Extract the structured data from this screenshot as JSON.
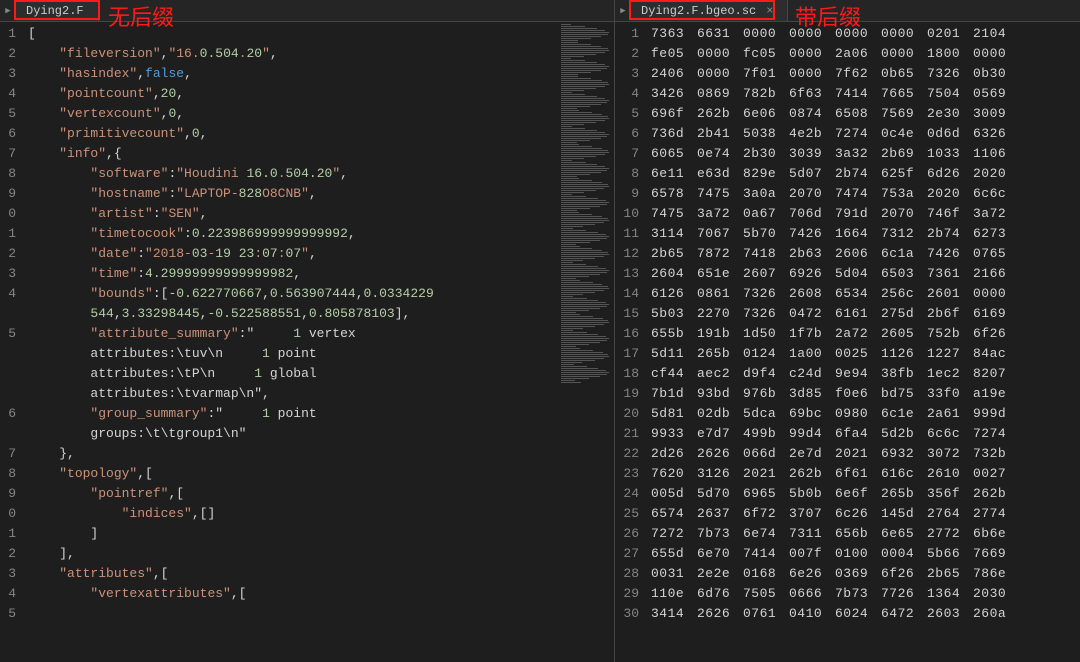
{
  "left": {
    "tab_title": "Dying2.F",
    "annotation": "无后缀",
    "lines": [
      "[",
      "    \"fileversion\",\"16.0.504.20\",",
      "    \"hasindex\",false,",
      "    \"pointcount\",20,",
      "    \"vertexcount\",0,",
      "    \"primitivecount\",0,",
      "    \"info\",{",
      "        \"software\":\"Houdini 16.0.504.20\",",
      "        \"hostname\":\"LAPTOP-828O8CNB\",",
      "        \"artist\":\"SEN\",",
      "        \"timetocook\":0.223986999999999992,",
      "        \"date\":\"2018-03-19 23:07:07\",",
      "        \"time\":4.29999999999999982,",
      "        \"bounds\":[-0.622770667,0.563907444,0.0334229",
      "        544,3.33298445,-0.522588551,0.805878103],",
      "        \"attribute_summary\":\"     1 vertex",
      "        attributes:\\tuv\\n     1 point",
      "        attributes:\\tP\\n     1 global",
      "        attributes:\\tvarmap\\n\",",
      "        \"group_summary\":\"     1 point",
      "        groups:\\t\\tgroup1\\n\"",
      "    },",
      "    \"topology\",[",
      "        \"pointref\",[",
      "            \"indices\",[]",
      "        ]",
      "    ],",
      "    \"attributes\",[",
      "        \"vertexattributes\",["
    ],
    "line_numbers": [
      "1",
      "2",
      "3",
      "4",
      "5",
      "6",
      "7",
      "8",
      "9",
      "0",
      "1",
      "2",
      "3",
      "4",
      "",
      "5",
      "",
      "",
      "",
      "6",
      "",
      "7",
      "8",
      "9",
      "0",
      "1",
      "2",
      "3",
      "4",
      "5"
    ]
  },
  "right": {
    "tab_title": "Dying2.F.bgeo.sc",
    "annotation": "带后缀",
    "hex_rows": [
      [
        "7363",
        "6631",
        "0000",
        "0000",
        "0000",
        "0000",
        "0201",
        "2104"
      ],
      [
        "fe05",
        "0000",
        "fc05",
        "0000",
        "2a06",
        "0000",
        "1800",
        "0000"
      ],
      [
        "2406",
        "0000",
        "7f01",
        "0000",
        "7f62",
        "0b65",
        "7326",
        "0b30"
      ],
      [
        "3426",
        "0869",
        "782b",
        "6f63",
        "7414",
        "7665",
        "7504",
        "0569"
      ],
      [
        "696f",
        "262b",
        "6e06",
        "0874",
        "6508",
        "7569",
        "2e30",
        "3009"
      ],
      [
        "736d",
        "2b41",
        "5038",
        "4e2b",
        "7274",
        "0c4e",
        "0d6d",
        "6326"
      ],
      [
        "6065",
        "0e74",
        "2b30",
        "3039",
        "3a32",
        "2b69",
        "1033",
        "1106"
      ],
      [
        "6e11",
        "e63d",
        "829e",
        "5d07",
        "2b74",
        "625f",
        "6d26",
        "2020"
      ],
      [
        "6578",
        "7475",
        "3a0a",
        "2070",
        "7474",
        "753a",
        "2020",
        "6c6c"
      ],
      [
        "7475",
        "3a72",
        "0a67",
        "706d",
        "791d",
        "2070",
        "746f",
        "3a72"
      ],
      [
        "3114",
        "7067",
        "5b70",
        "7426",
        "1664",
        "7312",
        "2b74",
        "6273"
      ],
      [
        "2b65",
        "7872",
        "7418",
        "2b63",
        "2606",
        "6c1a",
        "7426",
        "0765"
      ],
      [
        "2604",
        "651e",
        "2607",
        "6926",
        "5d04",
        "6503",
        "7361",
        "2166"
      ],
      [
        "6126",
        "0861",
        "7326",
        "2608",
        "6534",
        "256c",
        "2601",
        "0000"
      ],
      [
        "5b03",
        "2270",
        "7326",
        "0472",
        "6161",
        "275d",
        "2b6f",
        "6169"
      ],
      [
        "655b",
        "191b",
        "1d50",
        "1f7b",
        "2a72",
        "2605",
        "752b",
        "6f26"
      ],
      [
        "5d11",
        "265b",
        "0124",
        "1a00",
        "0025",
        "1126",
        "1227",
        "84ac"
      ],
      [
        "cf44",
        "aec2",
        "d9f4",
        "c24d",
        "9e94",
        "38fb",
        "1ec2",
        "8207"
      ],
      [
        "7b1d",
        "93bd",
        "976b",
        "3d85",
        "f0e6",
        "bd75",
        "33f0",
        "a19e"
      ],
      [
        "5d81",
        "02db",
        "5dca",
        "69bc",
        "0980",
        "6c1e",
        "2a61",
        "999d"
      ],
      [
        "9933",
        "e7d7",
        "499b",
        "99d4",
        "6fa4",
        "5d2b",
        "6c6c",
        "7274"
      ],
      [
        "2d26",
        "2626",
        "066d",
        "2e7d",
        "2021",
        "6932",
        "3072",
        "732b"
      ],
      [
        "7620",
        "3126",
        "2021",
        "262b",
        "6f61",
        "616c",
        "2610",
        "0027"
      ],
      [
        "005d",
        "5d70",
        "6965",
        "5b0b",
        "6e6f",
        "265b",
        "356f",
        "262b"
      ],
      [
        "6574",
        "2637",
        "6f72",
        "3707",
        "6c26",
        "145d",
        "2764",
        "2774"
      ],
      [
        "7272",
        "7b73",
        "6e74",
        "7311",
        "656b",
        "6e65",
        "2772",
        "6b6e"
      ],
      [
        "655d",
        "6e70",
        "7414",
        "007f",
        "0100",
        "0004",
        "5b66",
        "7669"
      ],
      [
        "0031",
        "2e2e",
        "0168",
        "6e26",
        "0369",
        "6f26",
        "2b65",
        "786e"
      ],
      [
        "110e",
        "6d76",
        "7505",
        "0666",
        "7b73",
        "7726",
        "1364",
        "2030"
      ],
      [
        "3414",
        "2626",
        "0761",
        "0410",
        "6024",
        "6472",
        "2603",
        "260a"
      ]
    ]
  }
}
